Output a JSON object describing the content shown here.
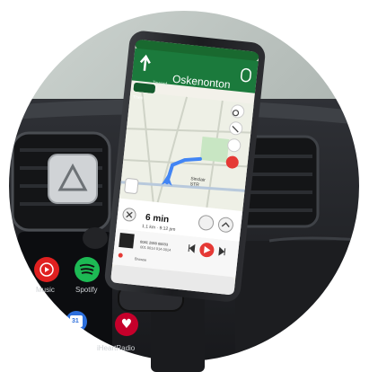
{
  "navigation": {
    "street": "Oskenonton",
    "prefix": "Toward",
    "then_label": "Then"
  },
  "trip": {
    "eta_minutes": "6 min",
    "details": "1.1 km · 9:12 pm"
  },
  "map": {
    "road_label": "Sinclair\nSTR"
  },
  "media": {
    "track_line1": "0081 2000 00033",
    "track_line2": "001 0014 014 0014",
    "source": "Browse"
  },
  "dock": {
    "music_app_label": "Music",
    "spotify_label": "Spotify",
    "iheart_label": "iHeartRadio",
    "calendar_day": "31"
  },
  "colors": {
    "nav_green": "#1b7a3c",
    "map_blue": "#4285f4",
    "record_red": "#e53935",
    "spotify_green": "#1db954",
    "youtube_red": "#e02020",
    "iheart_red": "#c6002b"
  }
}
